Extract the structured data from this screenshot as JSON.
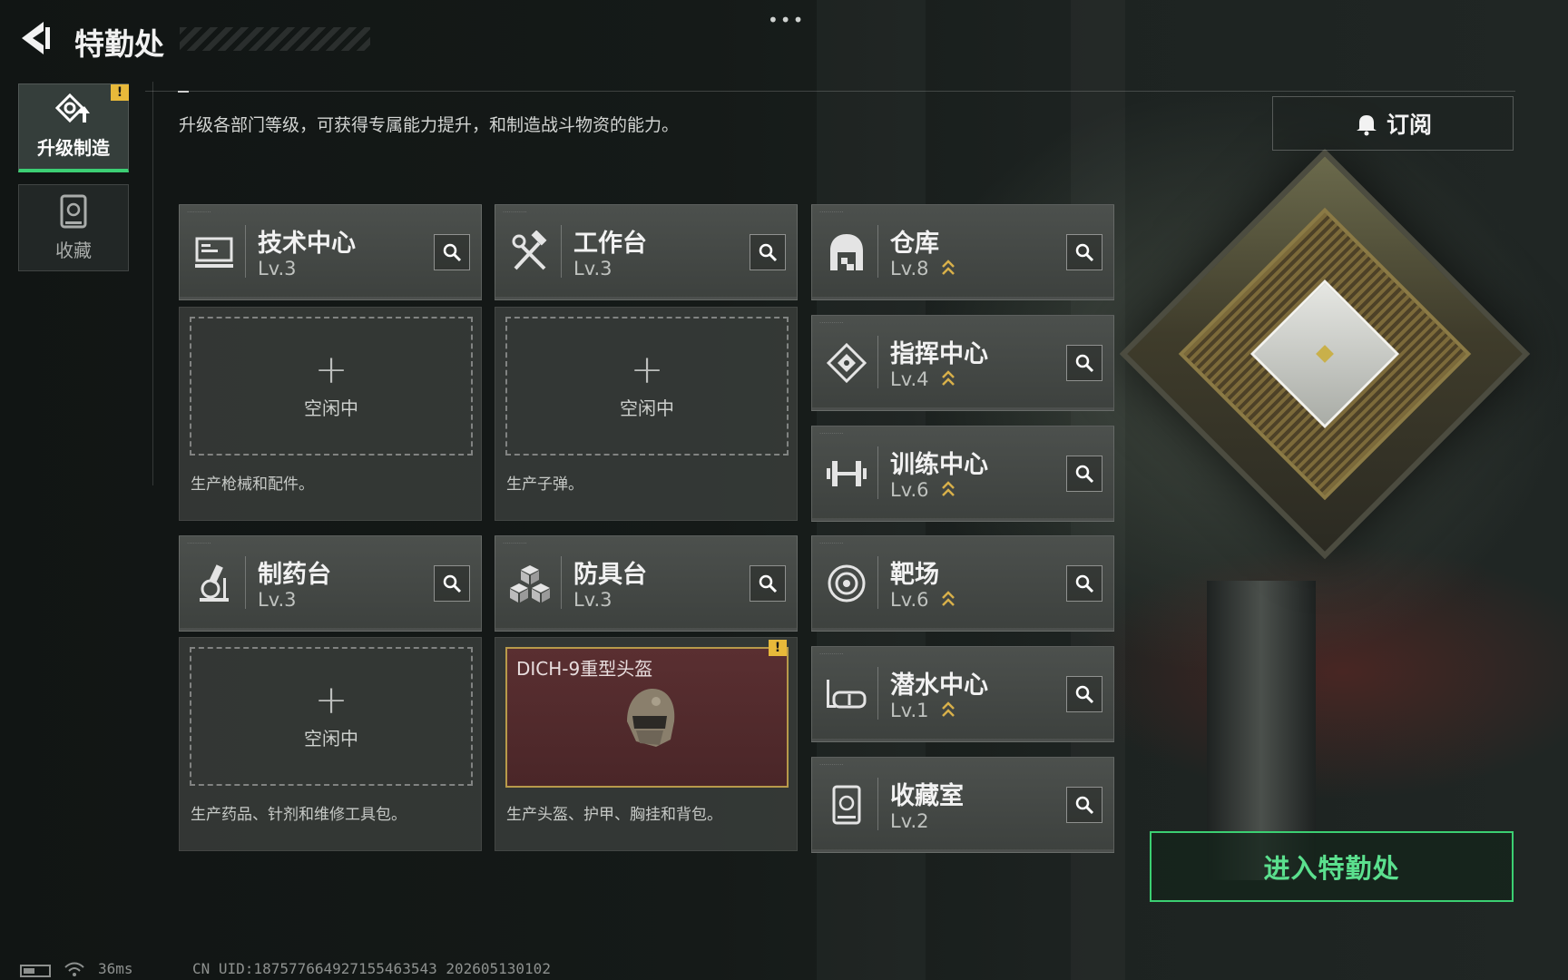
{
  "header": {
    "title": "特勤处",
    "menu": "•••"
  },
  "subtitle": "升级各部门等级，可获得专属能力提升，和制造战斗物资的能力。",
  "sidebar": {
    "tabs": [
      {
        "label": "升级制造",
        "icon": "upgrade-build-icon",
        "active": true,
        "badge": "!"
      },
      {
        "label": "收藏",
        "icon": "collection-icon",
        "active": false
      }
    ]
  },
  "facilities": [
    {
      "name": "技术中心",
      "level": "Lv.3",
      "icon": "monitor-icon",
      "upgradable": false
    },
    {
      "name": "工作台",
      "level": "Lv.3",
      "icon": "hammer-wrench-icon",
      "upgradable": false
    },
    {
      "name": "仓库",
      "level": "Lv.8",
      "icon": "warehouse-icon",
      "upgradable": true
    },
    {
      "name": "指挥中心",
      "level": "Lv.4",
      "icon": "command-icon",
      "upgradable": true
    },
    {
      "name": "训练中心",
      "level": "Lv.6",
      "icon": "dumbbell-icon",
      "upgradable": true
    },
    {
      "name": "制药台",
      "level": "Lv.3",
      "icon": "microscope-icon",
      "upgradable": false
    },
    {
      "name": "防具台",
      "level": "Lv.3",
      "icon": "cubes-icon",
      "upgradable": false
    },
    {
      "name": "靶场",
      "level": "Lv.6",
      "icon": "target-icon",
      "upgradable": true
    },
    {
      "name": "潜水中心",
      "level": "Lv.1",
      "icon": "diving-mask-icon",
      "upgradable": true
    },
    {
      "name": "收藏室",
      "level": "Lv.2",
      "icon": "collection-room-icon",
      "upgradable": false
    }
  ],
  "slots": [
    {
      "plus": "+",
      "status": "空闲中",
      "desc": "生产枪械和配件。"
    },
    {
      "plus": "+",
      "status": "空闲中",
      "desc": "生产子弹。"
    },
    {
      "plus": "+",
      "status": "空闲中",
      "desc": "生产药品、针剂和维修工具包。"
    },
    {
      "item": "DICH-9重型头盔",
      "badge": "!",
      "desc": "生产头盔、护甲、胸挂和背包。"
    }
  ],
  "buttons": {
    "subscribe": "订阅",
    "enter": "进入特勤处"
  },
  "status_bar": {
    "ping": "36ms",
    "uid": "CN UID:1875776649271554635​43 202605130102"
  },
  "colors": {
    "accent_green": "#3bcf72",
    "warning_yellow": "#e8b93a",
    "upgrade_gold": "#d8b04a",
    "crafting_red": "#5a2f31"
  }
}
